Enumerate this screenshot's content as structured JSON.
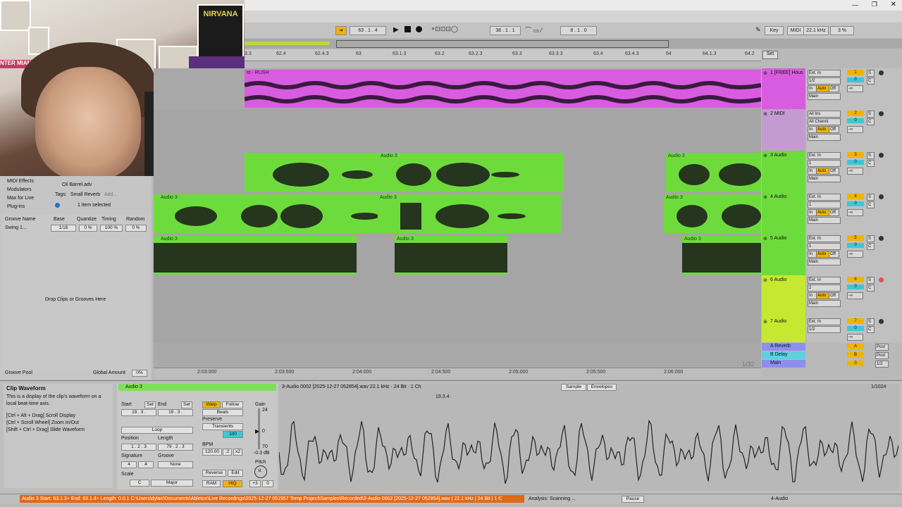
{
  "webcam": {
    "poster_text": "NIRVANA",
    "banner_text": "NTER MIAMI"
  },
  "transport": {
    "follow_icon": "follow-arrow-icon",
    "position": "63 . 1 . 4",
    "loop_start": "38 . 1 . 1",
    "loop_length": "8 . 1 . 0",
    "key_label": "Key",
    "midi_label": "MIDI",
    "sample_rate": "22.1 kHz",
    "cpu": "3 %"
  },
  "ruler": {
    "bars": [
      "3.3",
      "62.4",
      "62.4.3",
      "63",
      "63.1.3",
      "63.2",
      "63.2.3",
      "63.3",
      "63.3.3",
      "63.4",
      "63.4.3",
      "64",
      "64.1.3",
      "64.2"
    ],
    "set_label": "Set"
  },
  "browser": {
    "items": [
      "MIDI Effects",
      "Modulators",
      "Max for Live",
      "Plug-ins"
    ],
    "file_name": "Oil Barrel.adv",
    "tags_label": "Tags:",
    "tag": "Small Reverb",
    "tag_add": "Add...",
    "selected_info": "1 item selected"
  },
  "groove": {
    "headers": [
      "Groove Name",
      "Base",
      "Quantize",
      "Timing",
      "Random"
    ],
    "row": {
      "name": "Swing 1...",
      "base": "1/16",
      "quantize": "0 %",
      "timing": "100 %",
      "random": "0 %"
    },
    "drop_hint": "Drop Clips or Grooves Here",
    "pool_label": "Groove Pool",
    "global_amount_label": "Global Amount",
    "global_amount": "0%"
  },
  "tracks": [
    {
      "name": "1 [FREE] Hous",
      "color": "#d85cdf",
      "input": "Ext. In",
      "channel": "1/2",
      "num": "1"
    },
    {
      "name": "2 MIDI",
      "color": "#c49bd1",
      "input": "All Ins",
      "channel": "All Channi",
      "num": "2"
    },
    {
      "name": "3 Audio",
      "color": "#6edb3c",
      "input": "Ext. In",
      "channel": "1",
      "num": "3"
    },
    {
      "name": "4 Audio",
      "color": "#6edb3c",
      "input": "Ext. In",
      "channel": "1",
      "num": "4"
    },
    {
      "name": "5 Audio",
      "color": "#6edb3c",
      "input": "Ext. In",
      "channel": "1",
      "num": "5"
    },
    {
      "name": "6 Audio",
      "color": "#c7e831",
      "input": "Ext. In",
      "channel": "2",
      "num": "6"
    },
    {
      "name": "7 Audio",
      "color": "#c7e831",
      "input": "Ext. In",
      "channel": "1/2",
      "num": "7"
    }
  ],
  "mixer_common": {
    "monitor_in": "In",
    "monitor_auto": "Auto",
    "monitor_off": "Off",
    "output": "Main",
    "vol": "-∞",
    "pan": "C",
    "solo": "S",
    "zero": "0"
  },
  "returns": [
    {
      "name": "A Reverb",
      "letter": "A",
      "post": "Post"
    },
    {
      "name": "B Delay",
      "letter": "B",
      "post": "Post"
    },
    {
      "name": "Main",
      "letter": "0",
      "post": "1/2"
    }
  ],
  "clips": {
    "track1": "st - RUSH",
    "audio": "Audio 3"
  },
  "timeline": [
    "2:03:000",
    "2:03:500",
    "2:04:000",
    "2:04:500",
    "2:05:000",
    "2:05:500",
    "2:06:000"
  ],
  "zoom_ratio": "1/32",
  "detail": {
    "info_title": "Clip Waveform",
    "info_body": "This is a display of the clip's waveform on a local beat-time axis.",
    "info_hints": [
      "[Ctrl + Alt + Drag] Scroll Display",
      "[Ctrl + Scroll Wheel] Zoom In/Out",
      "[Shift + Ctrl + Drag] Slide Waveform"
    ],
    "clip_name": "Audio 3",
    "start_label": "Start",
    "end_label": "End",
    "set_label": "Set",
    "start_val": "19 . 3 .",
    "end_val": "19 . 3 .",
    "loop_label": "Loop",
    "position_label": "Position",
    "length_label": "Length",
    "position_val": "1 . 2 . 3",
    "length_val": "79 . 2 . 3",
    "signature_label": "Signature",
    "groove_label": "Groove",
    "sig_num": "4",
    "sig_den": "4",
    "groove_val": "None",
    "scale_label": "Scale",
    "scale_root": "C",
    "scale_mode": "Major",
    "warp": "Warp",
    "follow": "Follow",
    "beats": "Beats",
    "preserve_label": "Preserve",
    "preserve_val": "Transients",
    "grain": "100",
    "bpm_label": "BPM",
    "bpm": "120.00",
    "half": ":2",
    "double": "x2",
    "reverse": "Reverse",
    "edit": "Edit",
    "ram": "RAM",
    "hiq": "HiQ",
    "gain_label": "Gain",
    "gain_top": "24",
    "gain_mid": "0",
    "gain_bot": "70",
    "gain_val": "-0.3 dB",
    "pitch_label": "Pitch",
    "pitch_unit": "st",
    "pitch_val": "+3",
    "cents": "0",
    "file_info": "3-Audio 0002 [2025-12-27 052854].wav  22.1 kHz · 24 Bit · 1 Ch",
    "sample_tab": "Sample",
    "envelopes_tab": "Envelopes",
    "page_ratio": "1/1024",
    "marker": "19.3.4"
  },
  "status": {
    "text": "Audio 3  Start: 63.1.3+  End: 63.1.4+  Length: 0.0.1  C:\\Users\\dylan\\Documents\\Ableton\\Live Recordings\\2025-12-27 051957 Temp Project\\Samples\\Recorded\\3-Audio 0002 [2025-12-27 052854].wav | 22.1 kHz | 24 Bit | 1 C",
    "analysis": "Analysis: Scanning ...",
    "pause": "Pause",
    "track": "4-Audio"
  }
}
